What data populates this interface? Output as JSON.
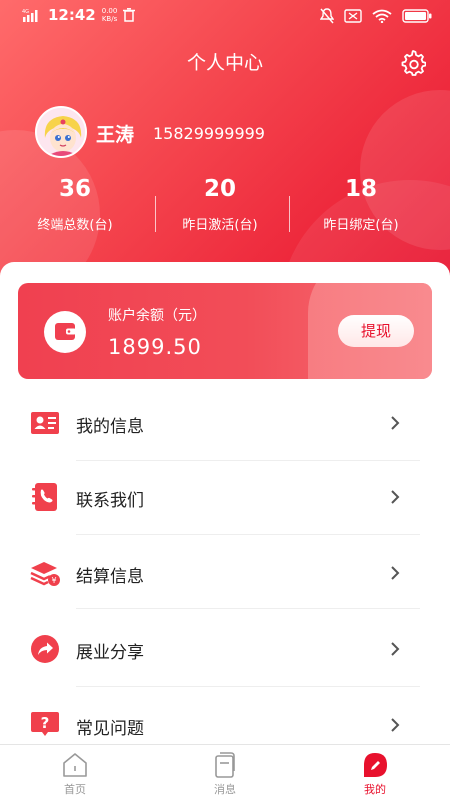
{
  "status_bar": {
    "network": "4G HD",
    "time": "12:42",
    "speed_value": "0.00",
    "speed_unit": "KB/s"
  },
  "header": {
    "title": "个人中心",
    "settings_icon": "gear-icon"
  },
  "profile": {
    "name": "王涛",
    "phone": "15829999999"
  },
  "stats": [
    {
      "value": "36",
      "label": "终端总数(台)"
    },
    {
      "value": "20",
      "label": "昨日激活(台)"
    },
    {
      "value": "18",
      "label": "昨日绑定(台)"
    }
  ],
  "balance": {
    "label": "账户余额（元）",
    "value": "1899.50",
    "withdraw_label": "提现"
  },
  "menu": [
    {
      "label": "我的信息",
      "icon": "id-card-icon"
    },
    {
      "label": "联系我们",
      "icon": "phone-book-icon"
    },
    {
      "label": "结算信息",
      "icon": "money-stack-icon"
    },
    {
      "label": "展业分享",
      "icon": "share-icon"
    },
    {
      "label": "常见问题",
      "icon": "question-icon"
    }
  ],
  "tabs": [
    {
      "label": "首页",
      "icon": "home-icon",
      "active": false
    },
    {
      "label": "消息",
      "icon": "message-icon",
      "active": false
    },
    {
      "label": "我的",
      "icon": "profile-pen-icon",
      "active": true
    }
  ],
  "colors": {
    "brand_red": "#e8112d",
    "header_light": "#ff6b6b",
    "text_dark": "#222222",
    "tab_inactive": "#999999"
  }
}
